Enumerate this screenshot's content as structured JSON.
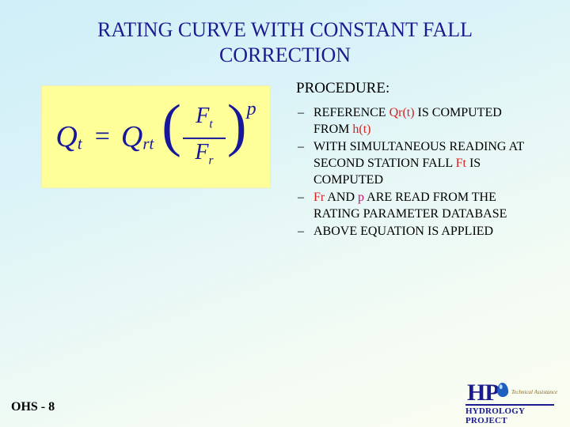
{
  "slide": {
    "title_line1": "RATING CURVE WITH CONSTANT FALL",
    "title_line2": "CORRECTION",
    "footer": "OHS - 8"
  },
  "formula": {
    "lhs_base": "Q",
    "lhs_sub": "t",
    "equals": "=",
    "rhs_base": "Q",
    "rhs_sub": "rt",
    "numer_base": "F",
    "numer_sub": "t",
    "denom_base": "F",
    "denom_sub": "r",
    "exponent": "p",
    "paren_open": "(",
    "paren_close": ")"
  },
  "procedure": {
    "heading": "PROCEDURE:",
    "dash": "–",
    "items": [
      {
        "p1": "REFERENCE ",
        "hl1": "Qr(t)",
        "p2": " IS COMPUTED FROM ",
        "hl2": "h(t)",
        "p3": ""
      },
      {
        "p1": "WITH SIMULTANEOUS READING AT SECOND STATION FALL ",
        "hl1": "Ft",
        "p2": " IS COMPUTED",
        "hl2": "",
        "p3": ""
      },
      {
        "p1": "",
        "hl1": "Fr",
        "p2": " AND ",
        "hl2": "p",
        "p3": " ARE READ FROM THE RATING PARAMETER DATABASE"
      },
      {
        "p1": "ABOVE EQUATION IS APPLIED",
        "hl1": "",
        "p2": "",
        "hl2": "",
        "p3": ""
      }
    ]
  },
  "logo": {
    "mark": "HP",
    "tagline": "Technical Assistance",
    "subtitle": "HYDROLOGY PROJECT"
  },
  "colors": {
    "title": "#1b1b8f",
    "formula": "#17179c",
    "highlight_red": "#d62222",
    "highlight_magenta": "#c0166e",
    "formula_bg": "#ffff99"
  }
}
